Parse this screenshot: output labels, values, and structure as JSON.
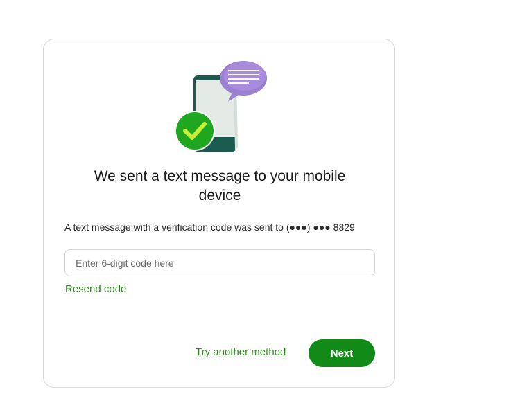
{
  "verification": {
    "heading_line1": "We sent a text message to your mobile",
    "heading_line2": "device",
    "description": "A text message with a verification code was sent to (●●●) ●●● 8829",
    "code_input": {
      "value": "",
      "placeholder": "Enter 6-digit code here"
    },
    "resend_label": "Resend code",
    "try_another_label": "Try another method",
    "next_label": "Next"
  },
  "illustration": {
    "icons": [
      "phone-icon",
      "chat-bubble-icon",
      "check-circle-icon"
    ]
  },
  "colors": {
    "primary_green": "#118a17",
    "link_green": "#2e8b1f",
    "check_green": "#1fa81f",
    "check_mark": "#c8f03a",
    "bubble_purple": "#9b7fd0",
    "phone_dark": "#1b5a4f",
    "phone_screen": "#e4ebe6"
  }
}
